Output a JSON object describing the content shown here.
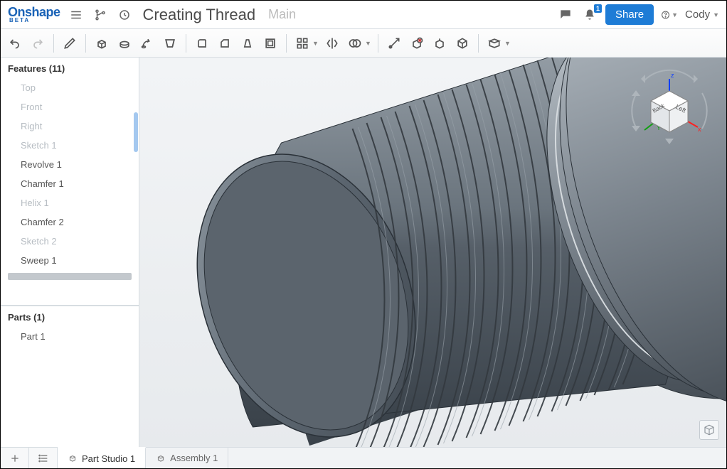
{
  "brand": {
    "name": "Onshape",
    "tag": "BETA"
  },
  "header": {
    "title": "Creating Thread",
    "workspace": "Main",
    "share_label": "Share",
    "notif_count": "1",
    "user": "Cody"
  },
  "features": {
    "header": "Features (11)",
    "items": [
      {
        "label": "Top",
        "dim": true
      },
      {
        "label": "Front",
        "dim": true
      },
      {
        "label": "Right",
        "dim": true
      },
      {
        "label": "Sketch 1",
        "dim": true
      },
      {
        "label": "Revolve 1",
        "dim": false
      },
      {
        "label": "Chamfer 1",
        "dim": false
      },
      {
        "label": "Helix 1",
        "dim": true
      },
      {
        "label": "Chamfer 2",
        "dim": false
      },
      {
        "label": "Sketch 2",
        "dim": true
      },
      {
        "label": "Sweep 1",
        "dim": false
      }
    ]
  },
  "parts": {
    "header": "Parts (1)",
    "items": [
      {
        "label": "Part 1"
      }
    ]
  },
  "tabs": {
    "items": [
      {
        "label": "Part Studio 1",
        "active": true
      },
      {
        "label": "Assembly 1",
        "active": false
      }
    ]
  },
  "viewcube": {
    "face1": "Left",
    "face2": "Back"
  },
  "colors": {
    "brand": "#1a63b7",
    "share": "#1E7CD6",
    "part": "#55606a"
  }
}
